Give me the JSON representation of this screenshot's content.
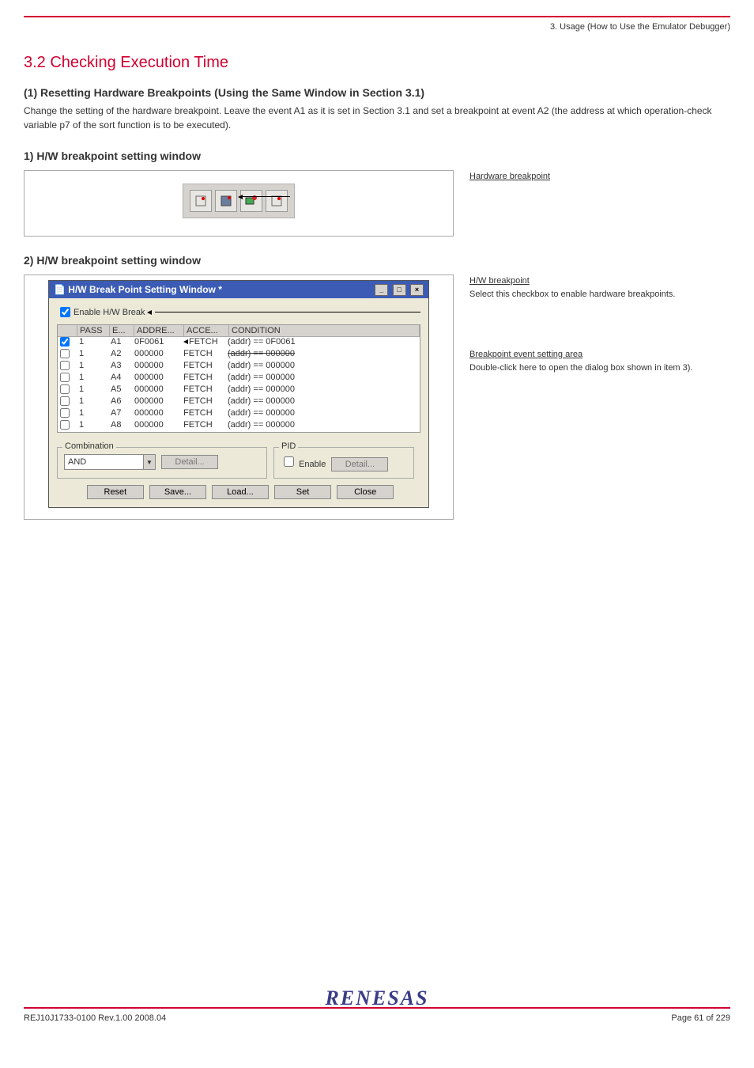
{
  "header": {
    "page_right": "3. Usage (How to Use the Emulator Debugger)"
  },
  "section_title": "3.2 Checking Execution Time",
  "step_heading": "(1) Resetting Hardware Breakpoints (Using the Same Window in Section 3.1)",
  "step_text": "Change the setting of the hardware breakpoint. Leave the event A1 as it is set in Section 3.1 and set a breakpoint at event A2 (the address at which operation-check variable p7 of the sort function is to be executed).",
  "step_sub1_title": "1) H/W breakpoint setting window",
  "toolbar_arrow": {
    "text": "Hardware breakpoint"
  },
  "step_sub2_title": "2) H/W breakpoint setting window",
  "callouts": {
    "r1_label": "H/W breakpoint",
    "r1_text": "Select this checkbox to enable hardware breakpoints.",
    "r2_label": "Breakpoint event setting area",
    "r2_text": "Double-click here to open the dialog box shown in item 3)."
  },
  "window": {
    "title": "H/W Break Point Setting Window *",
    "enable_label": "Enable H/W Break",
    "table": {
      "headers": {
        "pass": "PASS",
        "e": "E...",
        "addr": "ADDRE...",
        "acc": "ACCE...",
        "cond": "CONDITION"
      },
      "rows": [
        {
          "chk": true,
          "pass": "1",
          "e": "A1",
          "addr": "0F0061",
          "acc": "FETCH",
          "cond": "(addr) == 0F0061",
          "fetch_arrow": true
        },
        {
          "chk": false,
          "pass": "1",
          "e": "A2",
          "addr": "000000",
          "acc": "FETCH",
          "cond": "(addr) == 000000",
          "strike": true
        },
        {
          "chk": false,
          "pass": "1",
          "e": "A3",
          "addr": "000000",
          "acc": "FETCH",
          "cond": "(addr) == 000000"
        },
        {
          "chk": false,
          "pass": "1",
          "e": "A4",
          "addr": "000000",
          "acc": "FETCH",
          "cond": "(addr) == 000000"
        },
        {
          "chk": false,
          "pass": "1",
          "e": "A5",
          "addr": "000000",
          "acc": "FETCH",
          "cond": "(addr) == 000000"
        },
        {
          "chk": false,
          "pass": "1",
          "e": "A6",
          "addr": "000000",
          "acc": "FETCH",
          "cond": "(addr) == 000000"
        },
        {
          "chk": false,
          "pass": "1",
          "e": "A7",
          "addr": "000000",
          "acc": "FETCH",
          "cond": "(addr) == 000000"
        },
        {
          "chk": false,
          "pass": "1",
          "e": "A8",
          "addr": "000000",
          "acc": "FETCH",
          "cond": "(addr) == 000000"
        }
      ]
    },
    "combination": {
      "label": "Combination",
      "value": "AND",
      "detail_btn": "Detail..."
    },
    "pid": {
      "label": "PID",
      "enable_label": "Enable",
      "detail_btn": "Detail..."
    },
    "buttons": {
      "reset": "Reset",
      "save": "Save...",
      "load": "Load...",
      "set": "Set",
      "close": "Close"
    }
  },
  "footer": {
    "brand": "RENESAS",
    "left": "REJ10J1733-0100 Rev.1.00 2008.04",
    "right": "Page 61 of 229"
  }
}
